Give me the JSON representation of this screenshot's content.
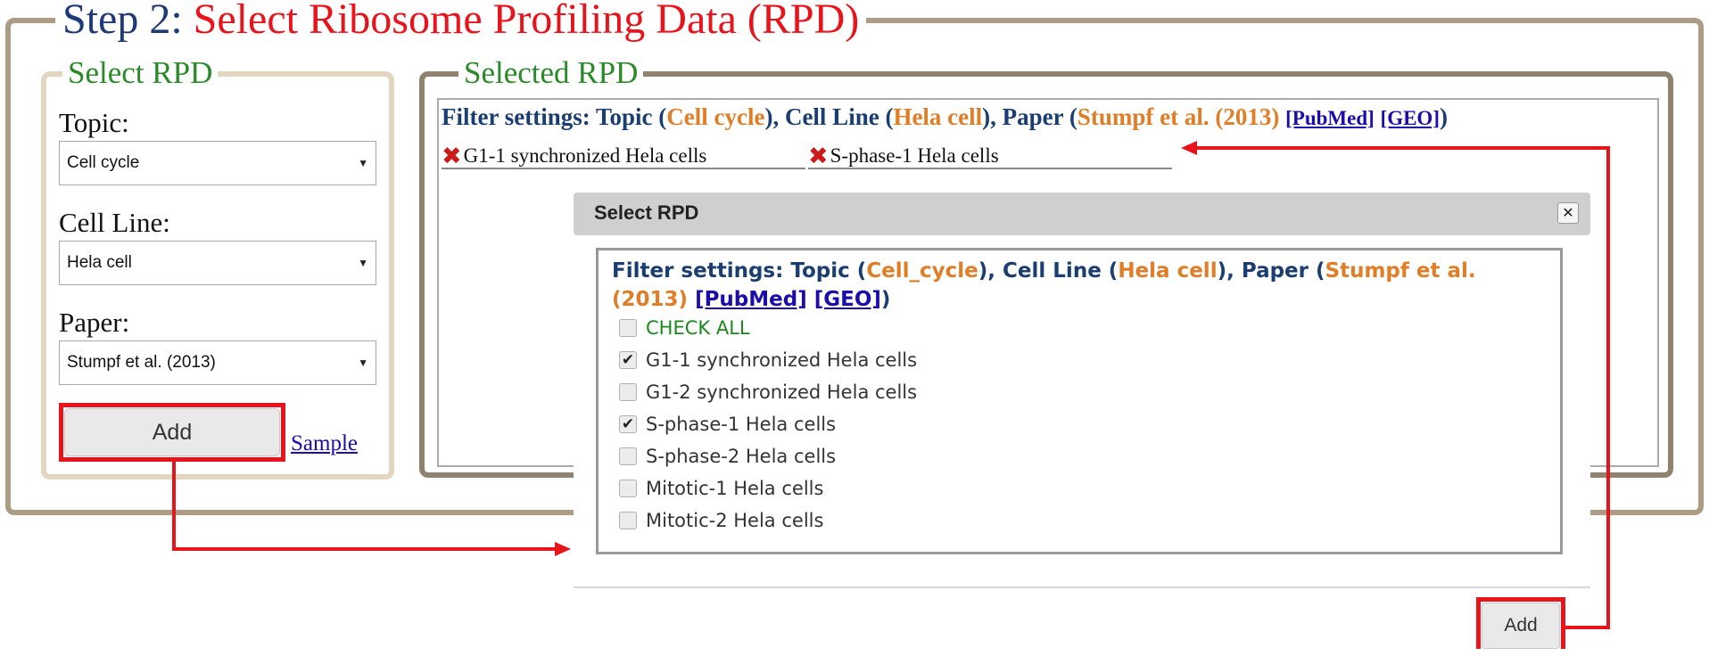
{
  "step": {
    "lead": "Step 2: ",
    "title": "Select Ribosome Profiling Data (RPD)"
  },
  "select_panel": {
    "legend": "Select RPD",
    "topic_label": "Topic:",
    "topic_value": "Cell cycle",
    "cell_line_label": "Cell Line:",
    "cell_line_value": "Hela cell",
    "paper_label": "Paper:",
    "paper_value": "Stumpf et al. (2013)",
    "add_label": "Add",
    "sample_link": "Sample"
  },
  "selected_panel": {
    "legend": "Selected RPD",
    "filter": {
      "prefix": "Filter settings: Topic (",
      "topic": "Cell cycle",
      "mid1": "), Cell Line (",
      "cell_line": "Hela cell",
      "mid2": "), Paper (",
      "paper": "Stumpf et al. (2013)",
      "pubmed": "[PubMed]",
      "geo": "[GEO]",
      "suffix": ")"
    },
    "tags": [
      "G1-1 synchronized Hela cells",
      "S-phase-1 Hela cells"
    ]
  },
  "dialog": {
    "title": "Select RPD",
    "filter": {
      "prefix": "Filter settings: Topic (",
      "topic": "Cell_cycle",
      "mid1": "), Cell Line (",
      "cell_line": "Hela cell",
      "mid2": "), Paper (",
      "paper": "Stumpf et al. (2013)",
      "pubmed": "[PubMed]",
      "geo": "[GEO]",
      "suffix": ")"
    },
    "check_all_label": "CHECK ALL",
    "items": [
      {
        "label": "G1-1 synchronized Hela cells",
        "checked": true
      },
      {
        "label": "G1-2 synchronized Hela cells",
        "checked": false
      },
      {
        "label": "S-phase-1 Hela cells",
        "checked": true
      },
      {
        "label": "S-phase-2 Hela cells",
        "checked": false
      },
      {
        "label": "Mitotic-1 Hela cells",
        "checked": false
      },
      {
        "label": "Mitotic-2 Hela cells",
        "checked": false
      }
    ],
    "add_label": "Add"
  },
  "colors": {
    "accent_red": "#e8141c",
    "title_blue": "#1b3e72",
    "value_orange": "#e07e28",
    "legend_green": "#2a8a28"
  },
  "icons": {
    "remove": "close-x-icon",
    "checkbox_checked": "checkmark-icon",
    "dialog_close": "close-icon",
    "dropdown": "chevron-down-icon"
  }
}
